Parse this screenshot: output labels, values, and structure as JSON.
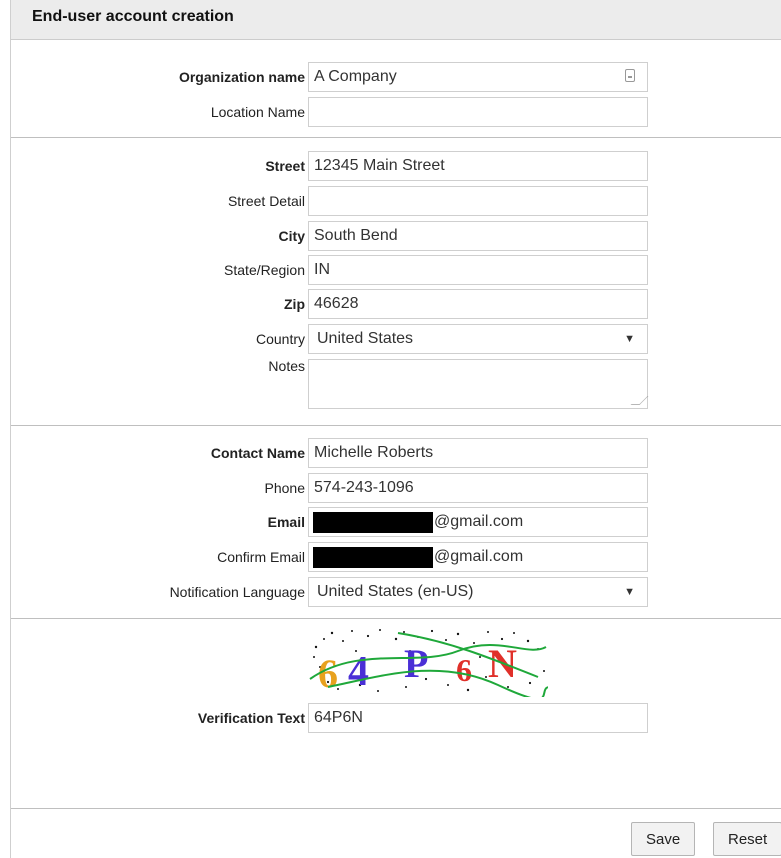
{
  "page_title": "End-user account creation",
  "organization": {
    "org_name_label": "Organization name",
    "org_name_value": "A Company",
    "location_label": "Location Name",
    "location_value": ""
  },
  "address": {
    "street_label": "Street",
    "street_value": "12345 Main Street",
    "street_detail_label": "Street Detail",
    "street_detail_value": "",
    "city_label": "City",
    "city_value": "South Bend",
    "state_label": "State/Region",
    "state_value": "IN",
    "zip_label": "Zip",
    "zip_value": "46628",
    "country_label": "Country",
    "country_value": "United States",
    "notes_label": "Notes",
    "notes_value": ""
  },
  "contact": {
    "name_label": "Contact Name",
    "name_value": "Michelle Roberts",
    "phone_label": "Phone",
    "phone_value": "574-243-1096",
    "email_label": "Email",
    "email_suffix": "@gmail.com",
    "confirm_email_label": "Confirm Email",
    "confirm_email_suffix": "@gmail.com",
    "language_label": "Notification Language",
    "language_value": "United States (en-US)"
  },
  "verification": {
    "captcha_text": "64P6N",
    "label": "Verification Text",
    "value": "64P6N"
  },
  "actions": {
    "save_label": "Save",
    "reset_label": "Reset"
  },
  "icons": {
    "dropdown": "chevron-down-icon",
    "autofill": "contact-card-icon"
  }
}
